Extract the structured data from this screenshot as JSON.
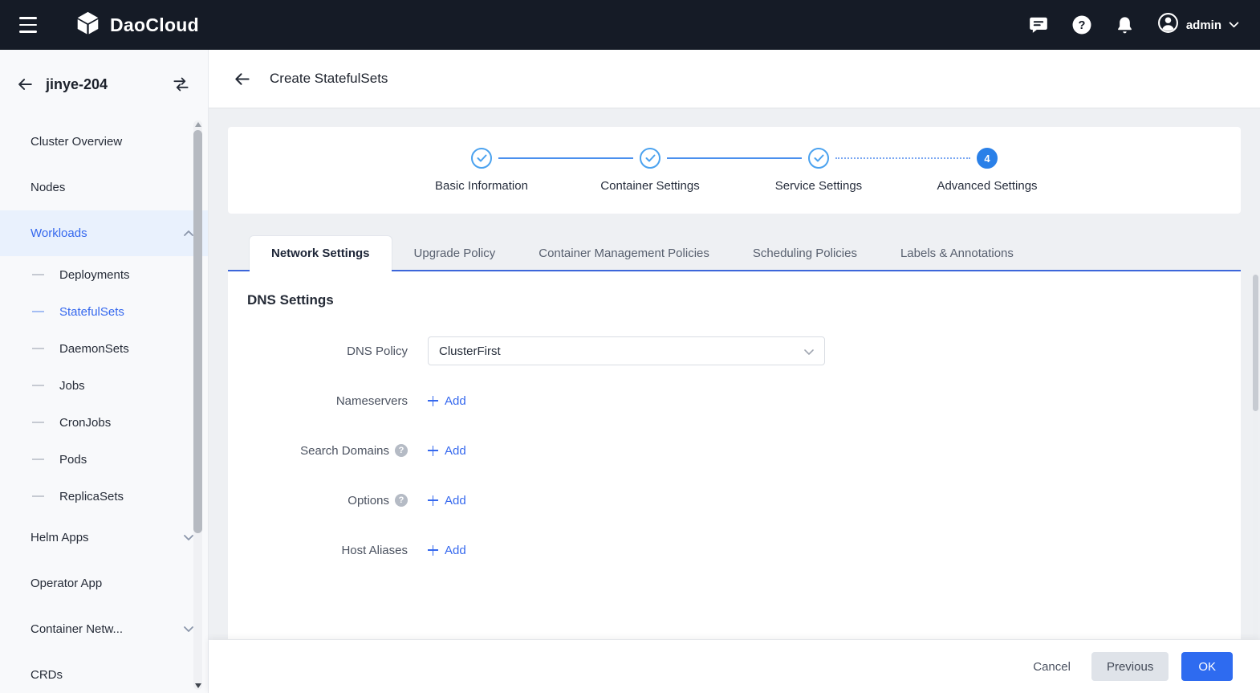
{
  "topbar": {
    "brand": "DaoCloud",
    "user": "admin"
  },
  "sidebar": {
    "cluster": "jinye-204",
    "items": [
      {
        "label": "Cluster Overview"
      },
      {
        "label": "Nodes"
      },
      {
        "label": "Workloads"
      },
      {
        "label": "Deployments"
      },
      {
        "label": "StatefulSets"
      },
      {
        "label": "DaemonSets"
      },
      {
        "label": "Jobs"
      },
      {
        "label": "CronJobs"
      },
      {
        "label": "Pods"
      },
      {
        "label": "ReplicaSets"
      },
      {
        "label": "Helm Apps"
      },
      {
        "label": "Operator App"
      },
      {
        "label": "Container Netw..."
      },
      {
        "label": "CRDs"
      }
    ]
  },
  "page": {
    "title": "Create StatefulSets"
  },
  "stepper": {
    "steps": [
      {
        "label": "Basic Information",
        "state": "done"
      },
      {
        "label": "Container Settings",
        "state": "done"
      },
      {
        "label": "Service Settings",
        "state": "done"
      },
      {
        "label": "Advanced Settings",
        "state": "current",
        "number": "4"
      }
    ]
  },
  "tabs": [
    {
      "label": "Network Settings",
      "active": true
    },
    {
      "label": "Upgrade Policy",
      "active": false
    },
    {
      "label": "Container Management Policies",
      "active": false
    },
    {
      "label": "Scheduling Policies",
      "active": false
    },
    {
      "label": "Labels & Annotations",
      "active": false
    }
  ],
  "form": {
    "section_title": "DNS Settings",
    "fields": [
      {
        "label": "DNS Policy",
        "type": "select",
        "value": "ClusterFirst"
      },
      {
        "label": "Nameservers",
        "type": "add",
        "action": "Add"
      },
      {
        "label": "Search Domains",
        "type": "add",
        "help": true,
        "action": "Add"
      },
      {
        "label": "Options",
        "type": "add",
        "help": true,
        "action": "Add"
      },
      {
        "label": "Host Aliases",
        "type": "add",
        "action": "Add"
      }
    ]
  },
  "footer": {
    "cancel": "Cancel",
    "previous": "Previous",
    "ok": "OK"
  },
  "colors": {
    "topbar_bg": "#151b26",
    "accent_link": "#3568ee",
    "primary_button": "#2e6bf0",
    "step_done": "#4ba2ef",
    "step_current": "#2a80e8",
    "active_nav_bg": "#e9f1fd",
    "tab_underline": "#3c66da"
  },
  "icons": {
    "topbar": [
      "menu-icon",
      "daocloud-logo-icon",
      "chat-icon",
      "help-icon",
      "bell-icon",
      "user-avatar-icon",
      "chevron-down-icon"
    ],
    "sidebar": [
      "back-arrow-icon",
      "switch-cluster-icon",
      "chevron-up-icon",
      "chevron-down-icon"
    ],
    "content": [
      "back-arrow-icon",
      "check-icon",
      "question-circle-icon",
      "plus-icon",
      "select-chevron-icon"
    ]
  }
}
